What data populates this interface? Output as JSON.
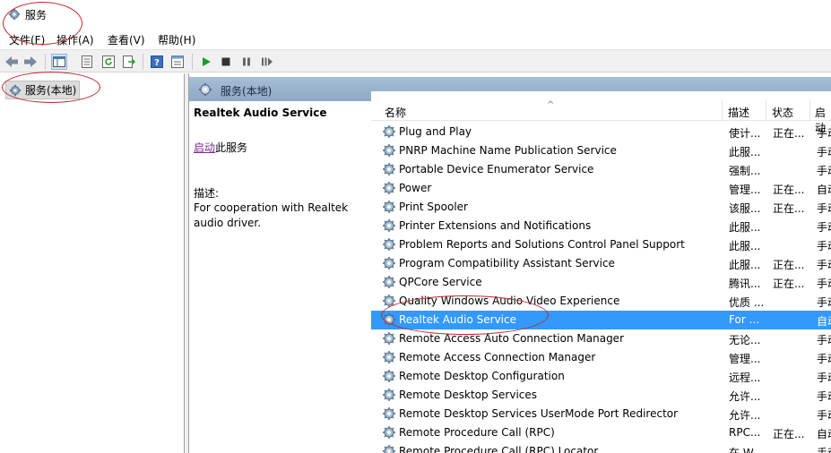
{
  "window": {
    "title": "服务"
  },
  "menu": [
    "文件(F)",
    "操作(A)",
    "查看(V)",
    "帮助(H)"
  ],
  "toolbar": {
    "icons": [
      "back-arrow-icon",
      "forward-arrow-icon",
      "console-tree-icon",
      "properties-icon",
      "refresh-icon",
      "export-list-icon",
      "help-icon",
      "view-icon",
      "play-icon",
      "stop-icon",
      "pause-icon",
      "resume-icon"
    ]
  },
  "tree": {
    "root_label": "服务(本地)"
  },
  "right_header": {
    "title": "服务(本地)"
  },
  "details": {
    "service_name": "Realtek Audio Service",
    "action_link": "启动",
    "action_suffix": "此服务",
    "description_label": "描述:",
    "description": "For cooperation with Realtek audio driver."
  },
  "columns": {
    "name": "名称",
    "description": "描述",
    "status": "状态",
    "startup": "启动"
  },
  "rows": [
    {
      "name": "Plug and Play",
      "desc": "使计...",
      "status": "正在...",
      "startup": "手动"
    },
    {
      "name": "PNRP Machine Name Publication Service",
      "desc": "此服...",
      "status": "",
      "startup": "手动"
    },
    {
      "name": "Portable Device Enumerator Service",
      "desc": "强制...",
      "status": "",
      "startup": "手动"
    },
    {
      "name": "Power",
      "desc": "管理...",
      "status": "正在...",
      "startup": "自动"
    },
    {
      "name": "Print Spooler",
      "desc": "该服...",
      "status": "正在...",
      "startup": "手动"
    },
    {
      "name": "Printer Extensions and Notifications",
      "desc": "此服...",
      "status": "",
      "startup": "手动"
    },
    {
      "name": "Problem Reports and Solutions Control Panel Support",
      "desc": "此服...",
      "status": "",
      "startup": "手动"
    },
    {
      "name": "Program Compatibility Assistant Service",
      "desc": "此服...",
      "status": "正在...",
      "startup": "手动"
    },
    {
      "name": "QPCore Service",
      "desc": "腾讯...",
      "status": "正在...",
      "startup": "手动"
    },
    {
      "name": "Quality Windows Audio Video Experience",
      "desc": "优质 ...",
      "status": "",
      "startup": "手动"
    },
    {
      "name": "Realtek Audio Service",
      "desc": "For ...",
      "status": "",
      "startup": "自动",
      "selected": true
    },
    {
      "name": "Remote Access Auto Connection Manager",
      "desc": "无论...",
      "status": "",
      "startup": "手动"
    },
    {
      "name": "Remote Access Connection Manager",
      "desc": "管理...",
      "status": "",
      "startup": "手动"
    },
    {
      "name": "Remote Desktop Configuration",
      "desc": "远程...",
      "status": "",
      "startup": "手动"
    },
    {
      "name": "Remote Desktop Services",
      "desc": "允许...",
      "status": "",
      "startup": "手动"
    },
    {
      "name": "Remote Desktop Services UserMode Port Redirector",
      "desc": "允许...",
      "status": "",
      "startup": "手动"
    },
    {
      "name": "Remote Procedure Call (RPC)",
      "desc": "RPC...",
      "status": "正在...",
      "startup": "自动"
    },
    {
      "name": "Remote Procedure Call (RPC) Locator",
      "desc": "在 W...",
      "status": "",
      "startup": "手动"
    }
  ],
  "colors": {
    "selection": "#3399ff",
    "annotation": "#c0272d",
    "link": "#7b2d8e"
  }
}
